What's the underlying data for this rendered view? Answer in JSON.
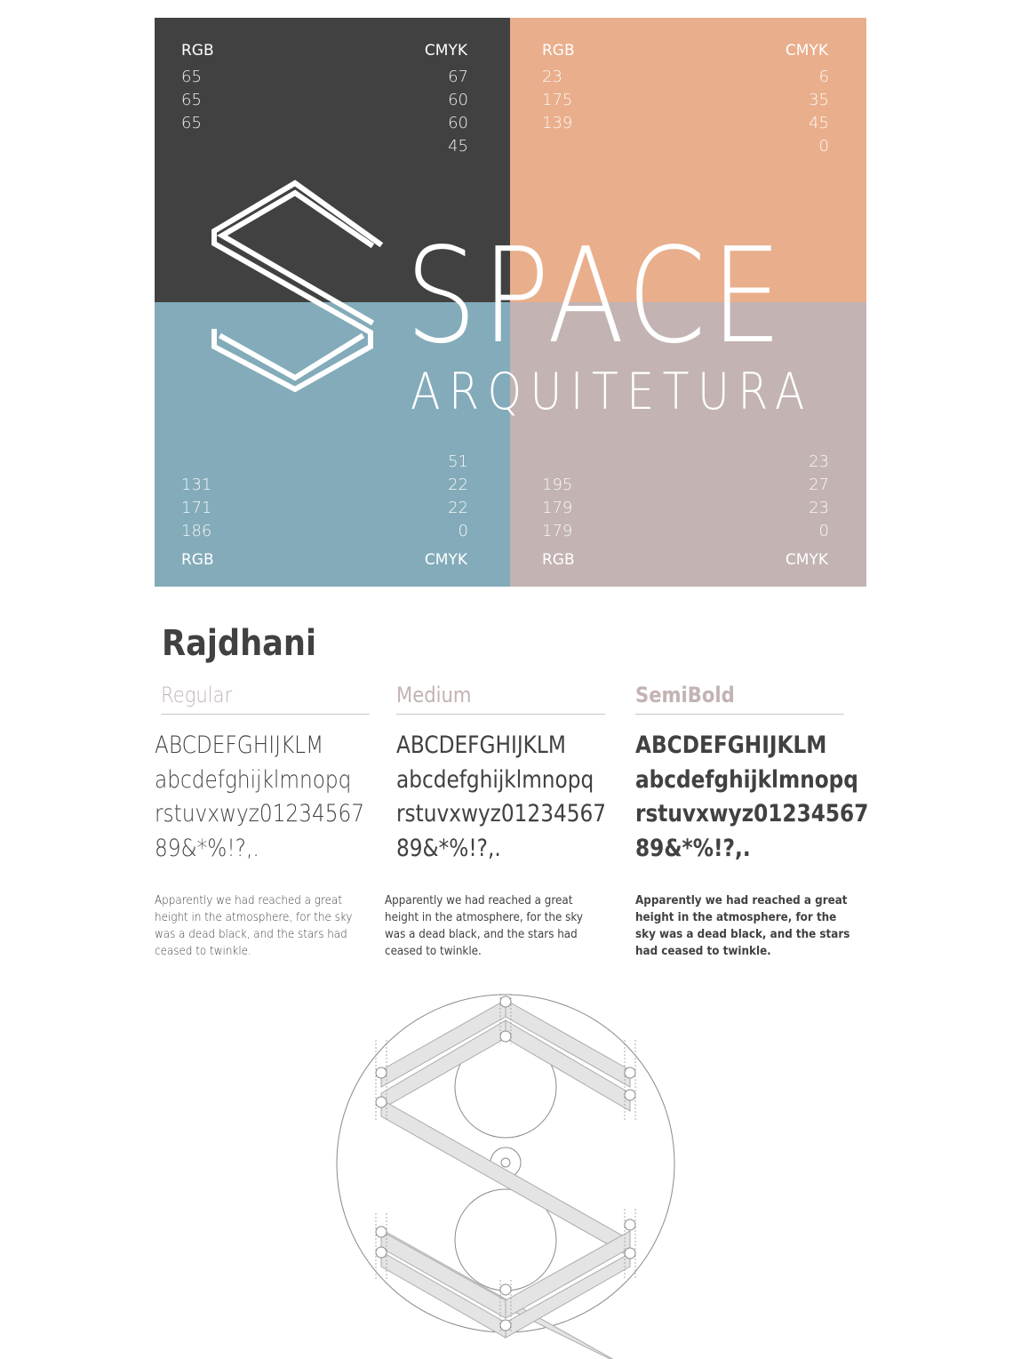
{
  "palette": {
    "dark": {
      "color": "#414141",
      "rgb_label": "RGB",
      "cmyk_label": "CMYK",
      "rgb": [
        "65",
        "65",
        "65"
      ],
      "cmyk": [
        "67",
        "60",
        "60",
        "45"
      ]
    },
    "orange": {
      "color": "#e9ae8b",
      "rgb_label": "RGB",
      "cmyk_label": "CMYK",
      "rgb": [
        "23",
        "175",
        "139"
      ],
      "cmyk": [
        "6",
        "35",
        "45",
        "0"
      ]
    },
    "blue": {
      "color": "#83abba",
      "rgb_label": "RGB",
      "cmyk_label": "CMYK",
      "rgb": [
        "131",
        "171",
        "186"
      ],
      "cmyk": [
        "51",
        "22",
        "22",
        "0"
      ]
    },
    "mauve": {
      "color": "#c3b3b3",
      "rgb_label": "RGB",
      "cmyk_label": "CMYK",
      "rgb": [
        "195",
        "179",
        "179"
      ],
      "cmyk": [
        "23",
        "27",
        "23",
        "0"
      ]
    }
  },
  "brand": {
    "word": "SPACE",
    "subtitle": "ARQUITETURA",
    "logo_icon": "s-monogram-icon"
  },
  "typography": {
    "font_name": "Rajdhani",
    "weights": [
      {
        "name": "Regular",
        "glyphs": [
          "ABCDEFGHIJKLM",
          "abcdefghijklmnopq",
          "rstuvxwyz01234567",
          "89&*%!?,."
        ],
        "sample": "Apparently we had reached a great height in the atmosphere, for the sky was a dead black, and the stars had ceased to twinkle."
      },
      {
        "name": "Medium",
        "glyphs": [
          "ABCDEFGHIJKLM",
          "abcdefghijklmnopq",
          "rstuvxwyz01234567",
          "89&*%!?,."
        ],
        "sample": "Apparently we had reached a great height in the atmosphere, for the sky was a dead black, and the stars had ceased to twinkle."
      },
      {
        "name": "SemiBold",
        "glyphs": [
          "ABCDEFGHIJKLM",
          "abcdefghijklmnopq",
          "rstuvxwyz01234567",
          "89&*%!?,."
        ],
        "sample": "Apparently we had reached a great height in the atmosphere, for the sky was a dead black, and the stars had ceased to twinkle."
      }
    ]
  },
  "construction": {
    "icon": "logo-construction-grid-icon"
  }
}
